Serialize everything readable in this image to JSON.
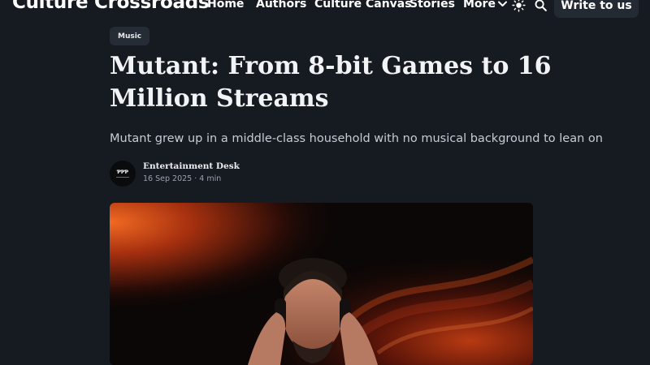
{
  "header": {
    "brand": "Culture Crossroads",
    "nav": [
      "Home",
      "Authors",
      "Culture Canvas",
      "Stories",
      "More"
    ],
    "write_label": "Write to us",
    "icons": {
      "theme": "sun-icon",
      "search": "search-icon",
      "more": "chevron-down-icon"
    }
  },
  "article": {
    "category": "Music",
    "title": "Mutant: From 8-bit Games to 16 Million Streams",
    "subtitle": "Mutant grew up in a middle-class household with no musical background to lean on",
    "author": {
      "name": "Entertainment Desk",
      "avatar_text": "ƤƤƤ"
    },
    "date": "16 Sep 2025",
    "read_time": "4 min",
    "meta": "16 Sep 2025 · 4 min"
  },
  "colors": {
    "background": "#161b22",
    "button": "#242a33",
    "badge": "#262c35",
    "hero_accent": "#e2531d"
  }
}
